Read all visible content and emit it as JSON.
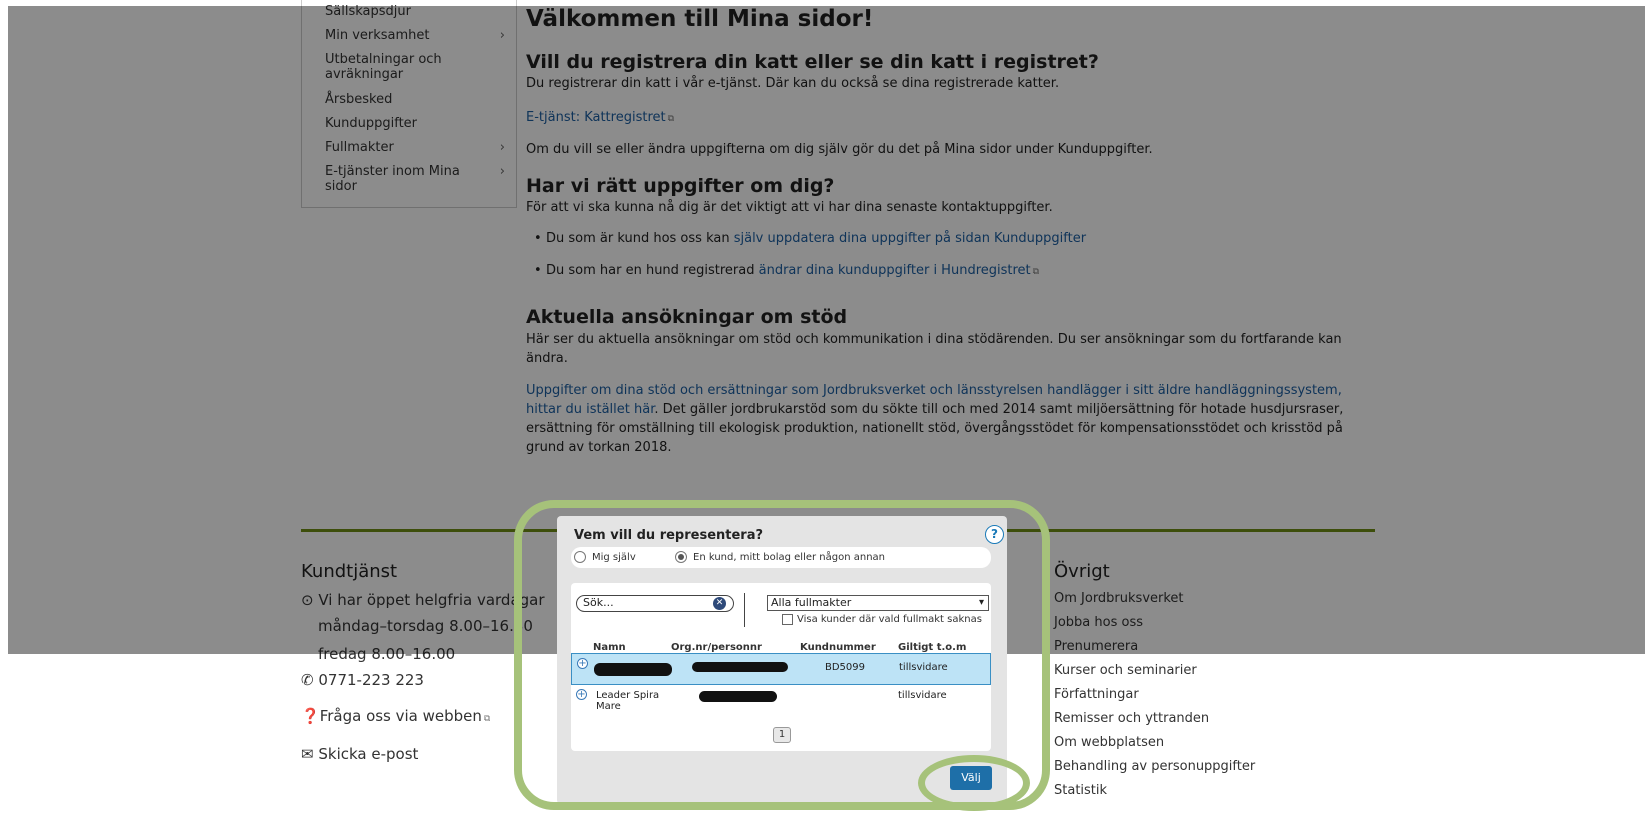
{
  "sidebar": {
    "items": [
      {
        "label": "Sällskapsdjur",
        "has_chevron": false
      },
      {
        "label": "Min verksamhet",
        "has_chevron": true
      },
      {
        "label": "Utbetalningar och avräkningar",
        "has_chevron": false
      },
      {
        "label": "Årsbesked",
        "has_chevron": false
      },
      {
        "label": "Kunduppgifter",
        "has_chevron": false
      },
      {
        "label": "Fullmakter",
        "has_chevron": true
      },
      {
        "label": "E-tjänster inom Mina sidor",
        "has_chevron": true
      }
    ],
    "chevron": "›"
  },
  "main": {
    "title": "Välkommen till Mina sidor!",
    "cat": {
      "heading": "Vill du registrera din katt eller se din katt i registret?",
      "text": "Du registrerar din katt i vår e-tjänst. Där kan du också se dina registrerade katter.",
      "link": "E-tjänst: Kattregistret",
      "text2": "Om du vill se eller ändra uppgifterna om dig själv gör du det på Mina sidor under Kunduppgifter."
    },
    "contact": {
      "heading": "Har vi rätt uppgifter om dig?",
      "text": "För att vi ska kunna nå dig är det viktigt att vi har dina senaste kontaktuppgifter.",
      "bullet1_text": "Du som är kund hos oss kan ",
      "bullet1_link": "själv uppdatera dina uppgifter på sidan Kunduppgifter",
      "bullet2_text": "Du som har en hund registrerad ",
      "bullet2_link": "ändrar dina kunduppgifter i Hundregistret"
    },
    "support": {
      "heading": "Aktuella ansökningar om stöd",
      "text": "Här ser du aktuella ansökningar om stöd och kommunikation i dina stödärenden. Du ser ansökningar som du fortfarande kan ändra.",
      "link": "Uppgifter om dina stöd och ersättningar som Jordbruksverket och länsstyrelsen handlägger i sitt äldre handläggningssystem, hittar du istället här",
      "text2": ". Det gäller jordbrukarstöd som du sökte till och med 2014 samt miljöersättning för hotade husdjursraser, ersättning för omställning till ekologisk produktion, nationellt stöd, övergångsstödet för kompensationsstödet och krisstöd på grund av torkan 2018."
    },
    "external_link_icon": "external-link-icon"
  },
  "footer": {
    "kundtjanst": {
      "heading": "Kundtjänst",
      "hours_intro": "Vi har öppet helgfria vardagar",
      "hours_mon_thu": "måndag–torsdag 8.00–16.30",
      "hours_fri": "fredag 8.00–16.00",
      "phone": "0771-223 223",
      "ask_web": "Fråga oss via webben",
      "email": "Skicka e-post"
    },
    "ovrigt": {
      "heading": "Övrigt",
      "links": [
        "Om Jordbruksverket",
        "Jobba hos oss",
        "Prenumerera",
        "Kurser och seminarier",
        "Författningar",
        "Remisser och yttranden",
        "Om webbplatsen",
        "Behandling av personuppgifter",
        "Statistik"
      ]
    }
  },
  "dialog": {
    "title": "Vem vill du representera?",
    "help": "?",
    "radio_self": "Mig själv",
    "radio_other": "En kund, mitt bolag eller någon annan",
    "selected_radio": "other",
    "search_placeholder": "Sök...",
    "search_clear": "✕",
    "filter_value": "Alla fullmakter",
    "filter_caret": "▾",
    "checkbox_label": "Visa kunder där vald fullmakt saknas",
    "columns": [
      "Namn",
      "Org.nr/personnr",
      "Kundnummer",
      "Giltigt t.o.m"
    ],
    "rows": [
      {
        "name": "",
        "kundnummer": "BD5099",
        "giltigt": "tillsvidare",
        "selected": true
      },
      {
        "name": "Leader Spira Mare",
        "kundnummer": "",
        "giltigt": "tillsvidare",
        "selected": false
      }
    ],
    "expand": "+",
    "page": "1",
    "choose_button": "Välj"
  },
  "colors": {
    "accent_green": "#6f8f14",
    "link_blue": "#1d5fa3",
    "button_blue": "#1e6fa8",
    "highlight_ring": "#a6c27a",
    "selected_row": "#bde3f6"
  }
}
